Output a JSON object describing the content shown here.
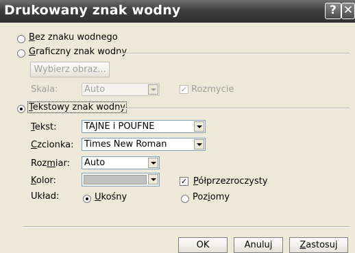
{
  "title": "Drukowany znak wodny",
  "titlebar": {
    "help_label": "?",
    "close_label": "✕"
  },
  "options": {
    "none": "Bez znaku wodnego",
    "picture": "Graficzny znak wodny",
    "text": "Tekstowy znak wodny"
  },
  "picture": {
    "select_button": "Wybierz obraz...",
    "scale_label": "Skala:",
    "scale_value": "Auto",
    "washout_label": "Rozmycie",
    "washout_checked": true
  },
  "text_fields": {
    "text_label": "Tekst:",
    "text_value": "TAJNE i POUFNE",
    "font_label": "Czcionka:",
    "font_value": "Times New Roman",
    "size_label": "Rozmiar:",
    "size_value": "Auto",
    "color_label": "Kolor:",
    "color_value": "#c0c0c0",
    "semitransparent_label": "Półprzezroczysty",
    "semitransparent_checked": true,
    "layout_label": "Układ:",
    "diagonal_label": "Ukośny",
    "horizontal_label": "Poziomy",
    "selected_layout": "diagonal"
  },
  "buttons": {
    "ok": "OK",
    "cancel": "Anuluj",
    "apply": "Zastosuj"
  }
}
